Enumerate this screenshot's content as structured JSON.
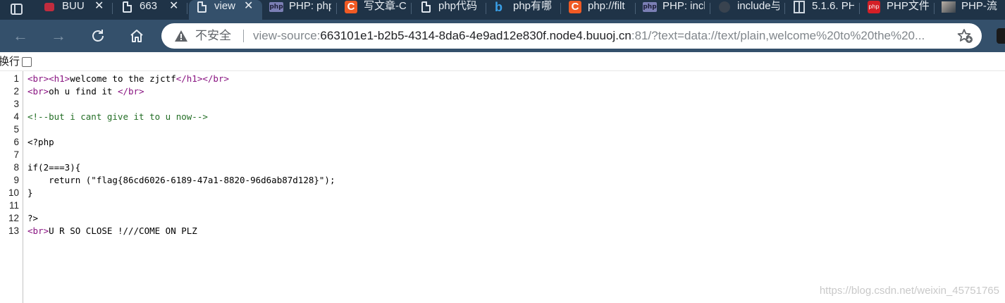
{
  "browser": {
    "tabs": [
      {
        "title": "BUU",
        "icon": "buuctf-icon",
        "has_close": true,
        "active": false
      },
      {
        "title": "663",
        "icon": "document-icon",
        "has_close": true,
        "active": false
      },
      {
        "title": "view",
        "icon": "document-icon",
        "has_close": true,
        "active": true
      },
      {
        "title": "PHP: php",
        "icon": "php-icon",
        "has_close": false,
        "active": false
      },
      {
        "title": "写文章-C",
        "icon": "csdn-icon",
        "has_close": false,
        "active": false
      },
      {
        "title": "php代码",
        "icon": "document-icon",
        "has_close": false,
        "active": false
      },
      {
        "title": "php有哪",
        "icon": "bing-icon",
        "has_close": false,
        "active": false
      },
      {
        "title": "php://filt",
        "icon": "csdn-icon",
        "has_close": false,
        "active": false
      },
      {
        "title": "PHP: incl",
        "icon": "php-icon",
        "has_close": false,
        "active": false
      },
      {
        "title": "include与",
        "icon": "github-icon",
        "has_close": false,
        "active": false
      },
      {
        "title": "5.1.6. PH",
        "icon": "book-icon",
        "has_close": false,
        "active": false
      },
      {
        "title": "PHP文件",
        "icon": "php-red-icon",
        "has_close": false,
        "active": false
      },
      {
        "title": "PHP-流",
        "icon": "avatar-icon",
        "has_close": false,
        "active": false
      }
    ],
    "close_glyph": "✕",
    "not_secure_label": "不安全",
    "url_scheme": "view-source:",
    "url_host": "663101e1-b2b5-4314-8da6-4e9ad12e830f.node4.buuoj.cn",
    "url_rest": ":81/?text=data://text/plain,welcome%20to%20the%20..."
  },
  "wrap_toggle": {
    "label": "换行",
    "checked": false
  },
  "source": {
    "line_numbers": [
      "1",
      "2",
      "3",
      "4",
      "5",
      "6",
      "7",
      "8",
      "9",
      "10",
      "11",
      "12",
      "13"
    ],
    "lines": [
      [
        {
          "t": "<br>",
          "c": "tag"
        },
        {
          "t": "<h1>",
          "c": "tag"
        },
        {
          "t": "welcome to the zjctf",
          "c": "txt"
        },
        {
          "t": "</h1>",
          "c": "tag"
        },
        {
          "t": "</br>",
          "c": "tag"
        }
      ],
      [
        {
          "t": "<br>",
          "c": "tag"
        },
        {
          "t": "oh u find it ",
          "c": "txt"
        },
        {
          "t": "</br>",
          "c": "tag"
        }
      ],
      [],
      [
        {
          "t": "<!--but i cant give it to u now-->",
          "c": "cmt"
        }
      ],
      [],
      [
        {
          "t": "<?php",
          "c": "txt"
        }
      ],
      [],
      [
        {
          "t": "if(2===3){",
          "c": "txt"
        }
      ],
      [
        {
          "t": "    return (\"flag{86cd6026-6189-47a1-8820-96d6ab87d128}\");",
          "c": "txt"
        }
      ],
      [
        {
          "t": "}",
          "c": "txt"
        }
      ],
      [],
      [
        {
          "t": "?>",
          "c": "txt"
        }
      ],
      [
        {
          "t": "<br>",
          "c": "tag"
        },
        {
          "t": "U R SO CLOSE !///COME ON PLZ",
          "c": "txt"
        }
      ]
    ]
  },
  "watermark": "https://blog.csdn.net/weixin_45751765",
  "colors": {
    "tab_strip": "#1f3347",
    "toolbar": "#34506b",
    "tag": "#881280",
    "comment": "#236e25"
  }
}
